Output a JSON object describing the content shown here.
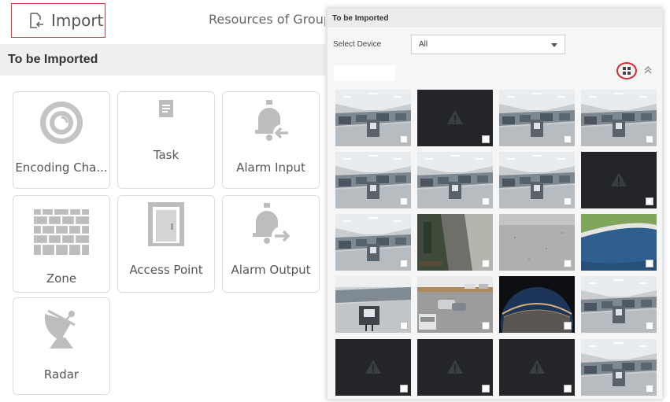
{
  "left_panel": {
    "import_label": "Import",
    "resources_tab_label": "Resources of Group",
    "section_title": "To be Imported",
    "tiles": [
      {
        "label": "Encoding Cha...",
        "icon": "camera-lens-icon"
      },
      {
        "label": "Task",
        "icon": "task-document-icon"
      },
      {
        "label": "Alarm Input",
        "icon": "alarm-input-icon"
      },
      {
        "label": "Zone",
        "icon": "brick-wall-icon"
      },
      {
        "label": "Access Point",
        "icon": "door-icon"
      },
      {
        "label": "Alarm Output",
        "icon": "alarm-output-icon"
      },
      {
        "label": "Radar",
        "icon": "radar-dish-icon"
      }
    ]
  },
  "right_panel": {
    "section_title": "To be Imported",
    "select_device_label": "Select Device",
    "select_device_value": "All",
    "view_toggle_icon": "grid-view-icon",
    "collapse_icon": "double-chevron-up-icon",
    "thumbnails": [
      "office",
      "no-signal",
      "office",
      "office",
      "office",
      "office",
      "office",
      "no-signal",
      "office",
      "alley",
      "concrete",
      "pool",
      "office-chair",
      "parking-lot",
      "fisheye-sky",
      "office",
      "no-signal",
      "no-signal",
      "no-signal",
      "office"
    ]
  },
  "colors": {
    "highlight_red": "#e0363c",
    "icon_gray": "#bdbdbd",
    "section_gray": "#efefef",
    "no_signal_bg": "#232528"
  }
}
